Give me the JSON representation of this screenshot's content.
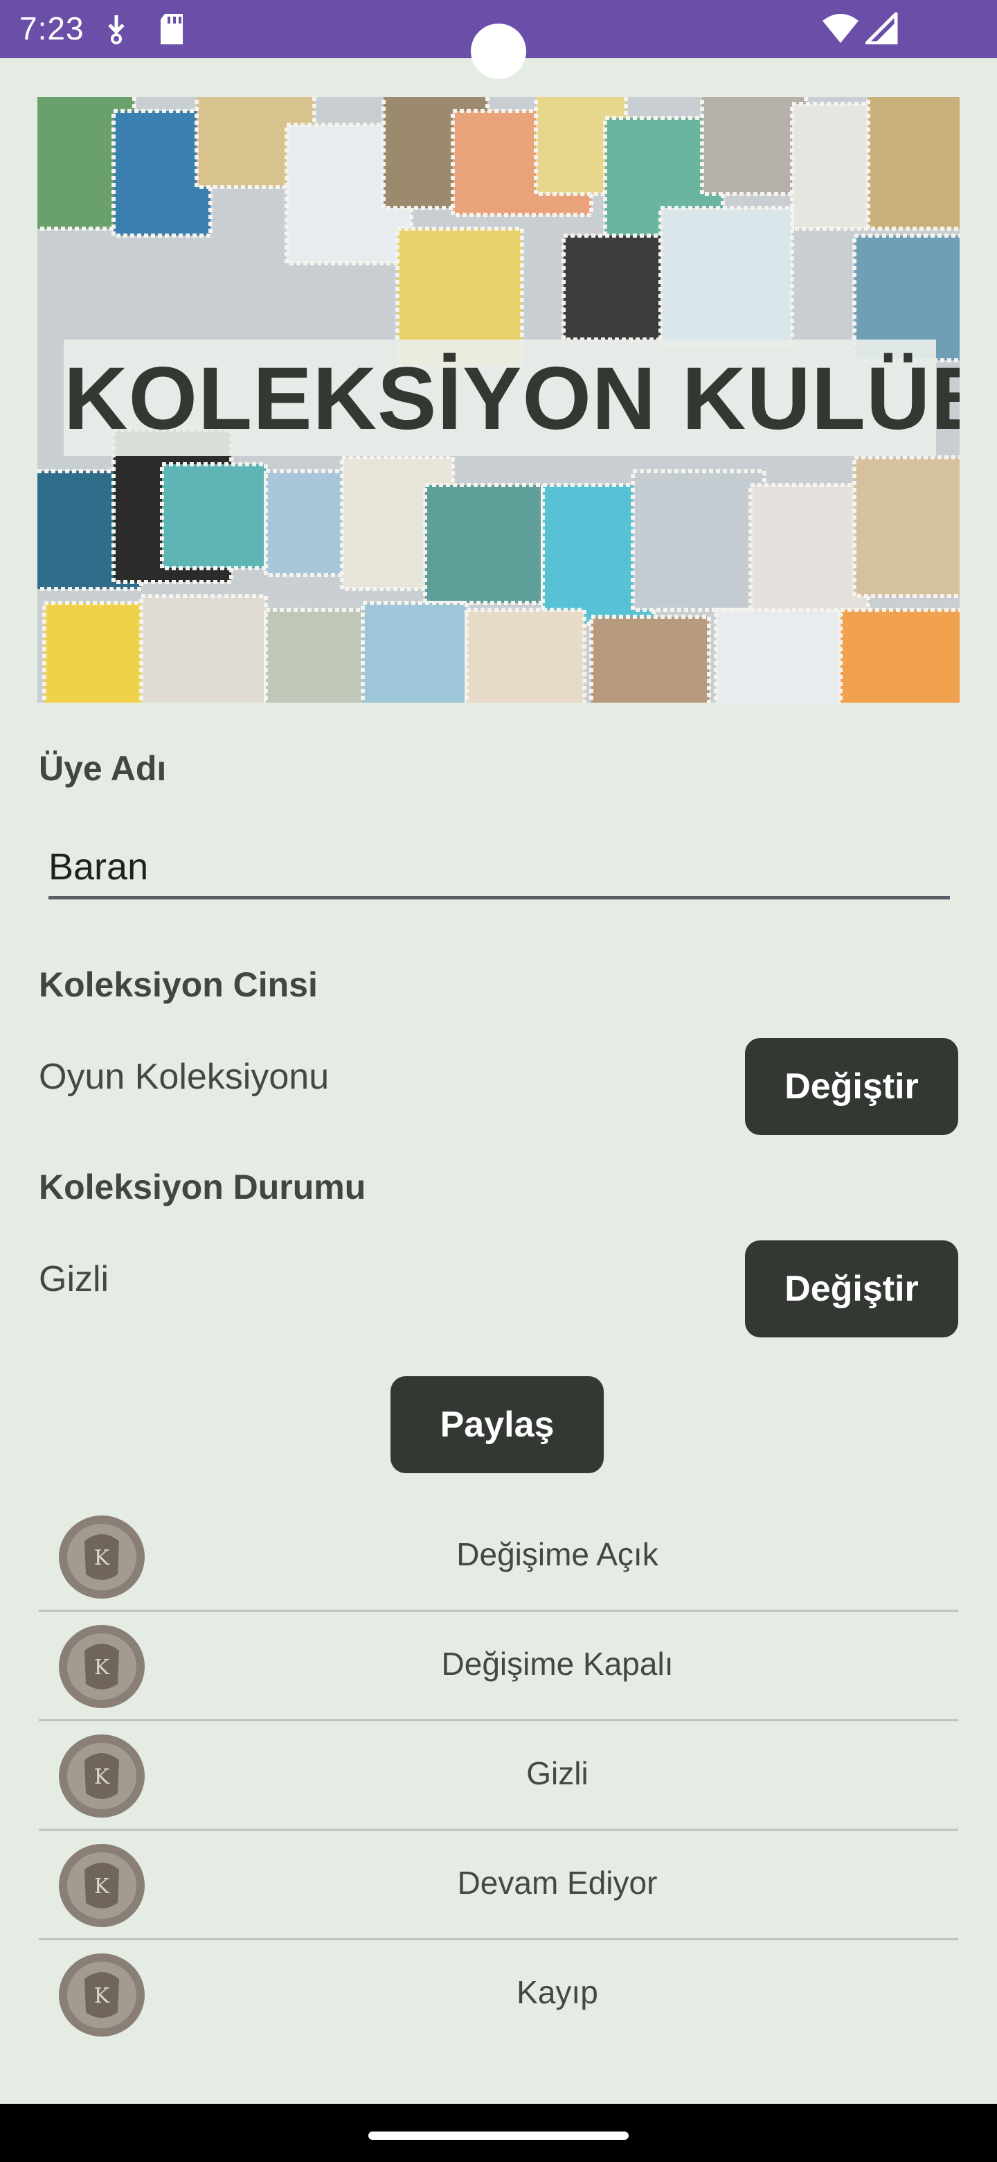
{
  "status_bar": {
    "time": "7:23",
    "background": "#6A4EA8",
    "icons": [
      "download-icon",
      "sd-card-icon",
      "wifi-icon",
      "signal-icon"
    ]
  },
  "banner": {
    "title": "KOLEKSİYON KULÜBÜ",
    "image": "stamp-collage"
  },
  "member": {
    "label": "Üye Adı",
    "value": "Baran"
  },
  "collection_type": {
    "label": "Koleksiyon Cinsi",
    "value": "Oyun Koleksiyonu",
    "button": "Değiştir"
  },
  "collection_status": {
    "label": "Koleksiyon Durumu",
    "value": "Gizli",
    "button": "Değiştir"
  },
  "share_button": "Paylaş",
  "status_list": [
    {
      "label": "Değişime Açık",
      "icon": "coin-icon"
    },
    {
      "label": "Değişime Kapalı",
      "icon": "coin-icon"
    },
    {
      "label": "Gizli",
      "icon": "coin-icon"
    },
    {
      "label": "Devam Ediyor",
      "icon": "coin-icon"
    },
    {
      "label": "Kayıp",
      "icon": "coin-icon"
    }
  ],
  "colors": {
    "background": "#E4ECE4",
    "button": "#333833",
    "accent": "#6A4EA8"
  }
}
